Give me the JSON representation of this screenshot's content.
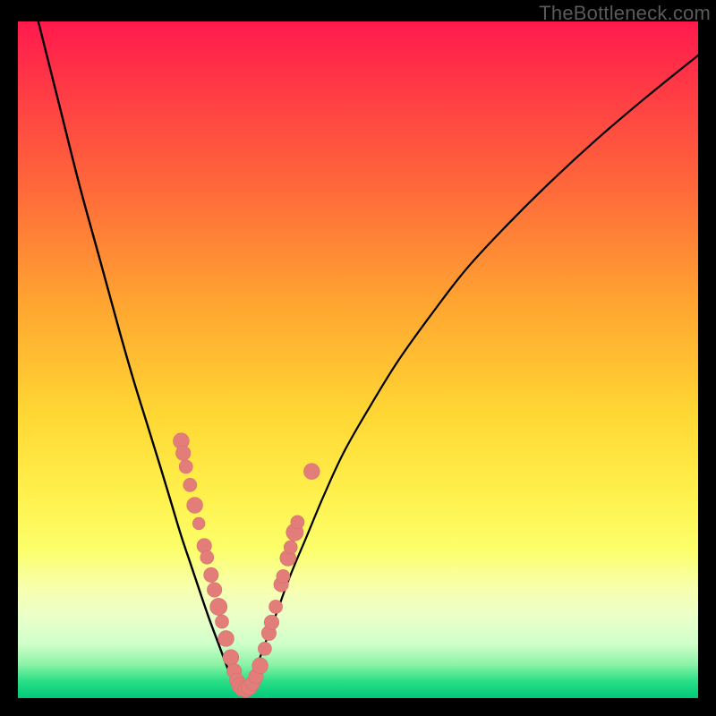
{
  "watermark": "TheBottleneck.com",
  "colors": {
    "frame": "#000000",
    "curve": "#000000",
    "marker_fill": "#e27d7a",
    "marker_stroke": "#d86f6c",
    "gradient_top": "#ff1a4d",
    "gradient_green": "#00c97a"
  },
  "chart_data": {
    "type": "line",
    "title": "",
    "xlabel": "",
    "ylabel": "",
    "xlim": [
      0,
      100
    ],
    "ylim": [
      0,
      100
    ],
    "note": "Axes unlabeled; values are read off as fraction of inner plot area (0-100). y=0 is bottom (green), y=100 is top (red). Two curves forming a V / check-mark shape.",
    "series": [
      {
        "name": "left-branch",
        "x": [
          3,
          6,
          9,
          12,
          15,
          17,
          19,
          21,
          22.5,
          24,
          25.5,
          27,
          28.2,
          29.5,
          30.8,
          32
        ],
        "y": [
          100,
          88,
          76,
          65,
          54,
          47,
          40.5,
          34,
          29,
          24,
          19.5,
          15,
          11.5,
          8,
          4.5,
          1.5
        ]
      },
      {
        "name": "right-branch",
        "x": [
          33.5,
          35,
          36.5,
          38,
          40,
          42.5,
          45,
          48,
          52,
          56,
          61,
          66,
          72,
          78,
          85,
          92,
          100
        ],
        "y": [
          1.5,
          4.5,
          8.5,
          12.5,
          18,
          24,
          30,
          36.5,
          43.5,
          50,
          57,
          63.5,
          70,
          76,
          82.5,
          88.5,
          95
        ]
      }
    ],
    "markers": [
      {
        "x": 24.0,
        "y": 38.0,
        "r": 1.3
      },
      {
        "x": 24.3,
        "y": 36.2,
        "r": 1.2
      },
      {
        "x": 24.7,
        "y": 34.2,
        "r": 1.1
      },
      {
        "x": 25.3,
        "y": 31.5,
        "r": 1.1
      },
      {
        "x": 26.0,
        "y": 28.5,
        "r": 1.3
      },
      {
        "x": 26.6,
        "y": 25.8,
        "r": 1.0
      },
      {
        "x": 27.4,
        "y": 22.5,
        "r": 1.2
      },
      {
        "x": 27.8,
        "y": 20.8,
        "r": 1.1
      },
      {
        "x": 28.4,
        "y": 18.2,
        "r": 1.2
      },
      {
        "x": 28.9,
        "y": 16.0,
        "r": 1.2
      },
      {
        "x": 29.5,
        "y": 13.5,
        "r": 1.4
      },
      {
        "x": 30.0,
        "y": 11.3,
        "r": 1.1
      },
      {
        "x": 30.6,
        "y": 8.8,
        "r": 1.3
      },
      {
        "x": 31.3,
        "y": 6.0,
        "r": 1.3
      },
      {
        "x": 31.8,
        "y": 4.0,
        "r": 1.2
      },
      {
        "x": 32.2,
        "y": 2.6,
        "r": 1.2
      },
      {
        "x": 32.6,
        "y": 1.8,
        "r": 1.3
      },
      {
        "x": 33.0,
        "y": 1.4,
        "r": 1.3
      },
      {
        "x": 33.5,
        "y": 1.3,
        "r": 1.3
      },
      {
        "x": 34.0,
        "y": 1.6,
        "r": 1.3
      },
      {
        "x": 34.5,
        "y": 2.2,
        "r": 1.2
      },
      {
        "x": 35.0,
        "y": 3.2,
        "r": 1.2
      },
      {
        "x": 35.6,
        "y": 4.8,
        "r": 1.3
      },
      {
        "x": 36.3,
        "y": 7.3,
        "r": 1.1
      },
      {
        "x": 36.9,
        "y": 9.6,
        "r": 1.2
      },
      {
        "x": 37.3,
        "y": 11.2,
        "r": 1.2
      },
      {
        "x": 37.9,
        "y": 13.5,
        "r": 1.1
      },
      {
        "x": 38.7,
        "y": 16.8,
        "r": 1.2
      },
      {
        "x": 39.0,
        "y": 18.0,
        "r": 1.1
      },
      {
        "x": 39.7,
        "y": 20.7,
        "r": 1.3
      },
      {
        "x": 40.1,
        "y": 22.3,
        "r": 1.1
      },
      {
        "x": 40.7,
        "y": 24.5,
        "r": 1.4
      },
      {
        "x": 41.1,
        "y": 26.0,
        "r": 1.1
      },
      {
        "x": 43.2,
        "y": 33.5,
        "r": 1.3
      }
    ]
  }
}
